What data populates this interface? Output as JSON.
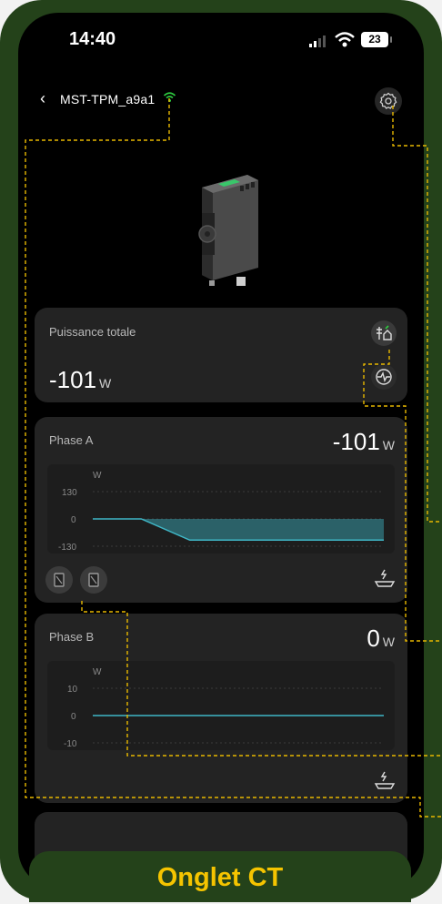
{
  "status_bar": {
    "time": "14:40",
    "battery": "23"
  },
  "header": {
    "device_name": "MST-TPM_a9a1"
  },
  "total_power": {
    "label": "Puissance totale",
    "value": "-101",
    "unit": "W"
  },
  "phase_a": {
    "label": "Phase A",
    "value": "-101",
    "unit": "W",
    "chart": {
      "y_unit": "W",
      "ticks": [
        "130",
        "0",
        "-130"
      ]
    }
  },
  "phase_b": {
    "label": "Phase B",
    "value": "0",
    "unit": "W",
    "chart": {
      "y_unit": "W",
      "ticks": [
        "10",
        "0",
        "-10"
      ]
    }
  },
  "chart_data": [
    {
      "type": "area",
      "series": [
        {
          "values": [
            0,
            0,
            -101,
            -101,
            -101,
            -101,
            -101
          ]
        }
      ],
      "yticks": [
        130,
        0,
        -130
      ],
      "ylim": [
        -130,
        130
      ],
      "ylabel": "W"
    },
    {
      "type": "line",
      "series": [
        {
          "values": [
            0,
            0,
            0,
            0,
            0,
            0,
            0
          ]
        }
      ],
      "yticks": [
        10,
        0,
        -10
      ],
      "ylim": [
        -10,
        10
      ],
      "ylabel": "W"
    }
  ],
  "banner": {
    "text": "Onglet CT"
  },
  "colors": {
    "accent_green": "#2ecc40",
    "chart_teal": "#3fb6c6",
    "banner_text": "#f5c400",
    "frame": "#24421a",
    "callout": "#e8b800"
  }
}
